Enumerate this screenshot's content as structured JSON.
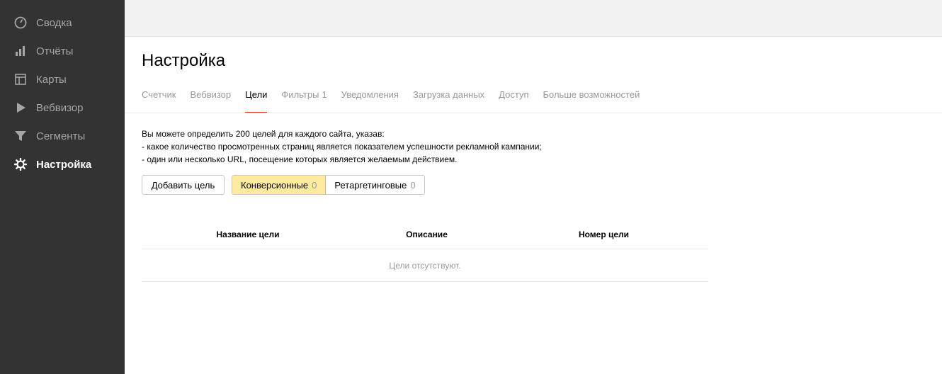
{
  "sidebar": {
    "items": [
      {
        "label": "Сводка",
        "icon": "dashboard-gauge-icon"
      },
      {
        "label": "Отчёты",
        "icon": "bar-chart-icon"
      },
      {
        "label": "Карты",
        "icon": "map-layout-icon"
      },
      {
        "label": "Вебвизор",
        "icon": "play-icon"
      },
      {
        "label": "Сегменты",
        "icon": "filter-funnel-icon"
      },
      {
        "label": "Настройка",
        "icon": "gear-icon",
        "active": true
      }
    ]
  },
  "page": {
    "title": "Настройка"
  },
  "tabs": [
    {
      "label": "Счетчик"
    },
    {
      "label": "Вебвизор"
    },
    {
      "label": "Цели",
      "active": true
    },
    {
      "label": "Фильтры",
      "count": "1"
    },
    {
      "label": "Уведомления"
    },
    {
      "label": "Загрузка данных"
    },
    {
      "label": "Доступ"
    },
    {
      "label": "Больше возможностей"
    }
  ],
  "info": {
    "line1": "Вы можете определить 200 целей для каждого сайта, указав:",
    "line2": "-  какое количество просмотренных страниц является показателем успешности рекламной кампании;",
    "line3": "-  один или несколько URL, посещение которых является желаемым действием."
  },
  "actions": {
    "add_goal": "Добавить цель",
    "conversion_label": "Конверсионные",
    "conversion_count": "0",
    "retargeting_label": "Ретаргетинговые",
    "retargeting_count": "0"
  },
  "table": {
    "columns": [
      "Название цели",
      "Описание",
      "Номер цели"
    ],
    "empty_text": "Цели отсутствуют."
  },
  "colors": {
    "sidebar_bg": "#333333",
    "accent_tab_underline": "#e5331b",
    "segment_active_bg": "#ffeba0"
  }
}
